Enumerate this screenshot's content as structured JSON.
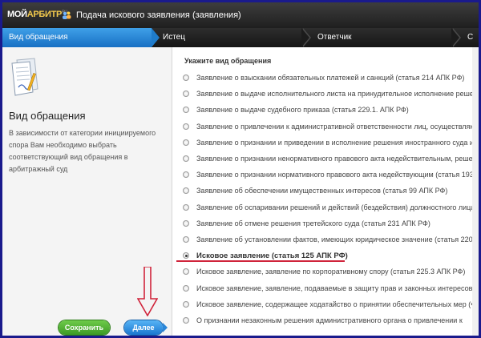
{
  "app": {
    "logo_part1": "МОЙ",
    "logo_part2": "АРБИТР",
    "logo_sup": "RU",
    "title": "Подача искового заявления (заявления)"
  },
  "steps": [
    {
      "label": "Вид обращения",
      "active": true
    },
    {
      "label": "Истец",
      "active": false
    },
    {
      "label": "Ответчик",
      "active": false
    },
    {
      "label": "С",
      "active": false
    }
  ],
  "left": {
    "title": "Вид обращения",
    "description": "В зависимости от категории инициируемого спора Вам необходимо выбрать соответствующий вид обращения в арбитражный суд",
    "save_label": "Сохранить",
    "next_label": "Далее"
  },
  "right": {
    "heading": "Укажите вид обращения",
    "options": [
      {
        "label": "Заявление о взыскании обязательных платежей и санкций (статья 214 АПК РФ)",
        "selected": false
      },
      {
        "label": "Заявление о выдаче исполнительного листа на принудительное исполнение решения тре",
        "selected": false
      },
      {
        "label": "Заявление о выдаче судебного приказа (статья 229.1. АПК РФ)",
        "selected": false
      },
      {
        "label": "Заявление о привлечении к административной ответственности лиц, осуществляющих",
        "selected": false
      },
      {
        "label": "Заявление о признании и приведении в исполнение решения иностранного суда и иност",
        "selected": false
      },
      {
        "label": "Заявление о признании ненормативного правового акта недействительным, решений и д",
        "selected": false
      },
      {
        "label": "Заявление о признании нормативного правового акта недействующим (статья 193 АПК Р",
        "selected": false
      },
      {
        "label": "Заявление об обеспечении имущественных интересов (статья 99 АПК РФ)",
        "selected": false
      },
      {
        "label": "Заявление об оспаривании решений и действий (бездействия) должностного лица служб",
        "selected": false
      },
      {
        "label": "Заявление об отмене решения третейского суда (статья 231 АПК РФ)",
        "selected": false
      },
      {
        "label": "Заявление об установлении фактов, имеющих юридическое значение (статья 220 АПК Р",
        "selected": false
      },
      {
        "label": "Исковое заявление (статья 125 АПК РФ)",
        "selected": true
      },
      {
        "label": "Исковое заявление, заявление по корпоративному спору (статья 225.3 АПК РФ)",
        "selected": false
      },
      {
        "label": "Исковое заявление, заявление, подаваемые в защиту прав и законных интересов групп",
        "selected": false
      },
      {
        "label": "Исковое заявление, содержащее ходатайство о принятии обеспечительных мер (часть 1",
        "selected": false
      },
      {
        "label": "О признании незаконным решения административного органа о привлечении к",
        "selected": false
      }
    ]
  },
  "colors": {
    "accent_blue": "#1f7ccb",
    "save_green": "#4aa82e",
    "highlight_red": "#d0243b",
    "frame_blue": "#1a1a8c"
  }
}
